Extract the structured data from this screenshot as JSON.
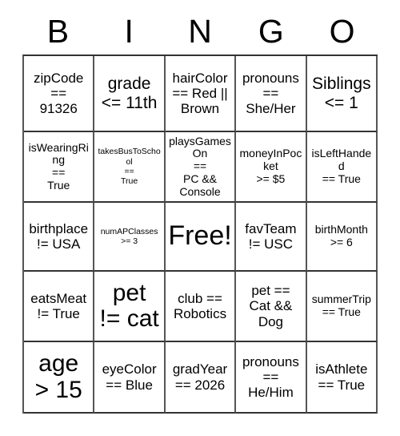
{
  "card": {
    "title_letters": [
      "B",
      "I",
      "N",
      "G",
      "O"
    ],
    "rows": [
      [
        {
          "text": "zipCode\n==\n91326",
          "size": "m"
        },
        {
          "text": "grade\n<= 11th",
          "size": "l"
        },
        {
          "text": "hairColor\n== Red ||\nBrown",
          "size": "m"
        },
        {
          "text": "pronouns\n==\nShe/Her",
          "size": "m"
        },
        {
          "text": "Siblings\n<= 1",
          "size": "l"
        }
      ],
      [
        {
          "text": "isWearingRing\n==\nTrue",
          "size": "s"
        },
        {
          "text": "takesBusToSchool\n==\nTrue",
          "size": "xs"
        },
        {
          "text": "playsGamesOn\n==\nPC && Console",
          "size": "s"
        },
        {
          "text": "moneyInPocket\n>= $5",
          "size": "s"
        },
        {
          "text": "isLeftHanded\n== True",
          "size": "s"
        }
      ],
      [
        {
          "text": "birthplace\n!= USA",
          "size": "m"
        },
        {
          "text": "numAPClasses\n>= 3",
          "size": "xs"
        },
        {
          "text": "Free!",
          "size": "free"
        },
        {
          "text": "favTeam\n!= USC",
          "size": "m"
        },
        {
          "text": "birthMonth\n>= 6",
          "size": "s"
        }
      ],
      [
        {
          "text": "eatsMeat\n!= True",
          "size": "m"
        },
        {
          "text": "pet\n!= cat",
          "size": "xl"
        },
        {
          "text": "club ==\nRobotics",
          "size": "m"
        },
        {
          "text": "pet ==\nCat &&\nDog",
          "size": "m"
        },
        {
          "text": "summerTrip\n== True",
          "size": "s"
        }
      ],
      [
        {
          "text": "age\n> 15",
          "size": "xl"
        },
        {
          "text": "eyeColor\n== Blue",
          "size": "m"
        },
        {
          "text": "gradYear\n== 2026",
          "size": "m"
        },
        {
          "text": "pronouns\n==\nHe/Him",
          "size": "m"
        },
        {
          "text": "isAthlete\n== True",
          "size": "m"
        }
      ]
    ]
  },
  "colors": {
    "background": "#ffffff",
    "text": "#000000",
    "grid_line_horizontal": "#333333",
    "grid_line_vertical": "#555555"
  }
}
